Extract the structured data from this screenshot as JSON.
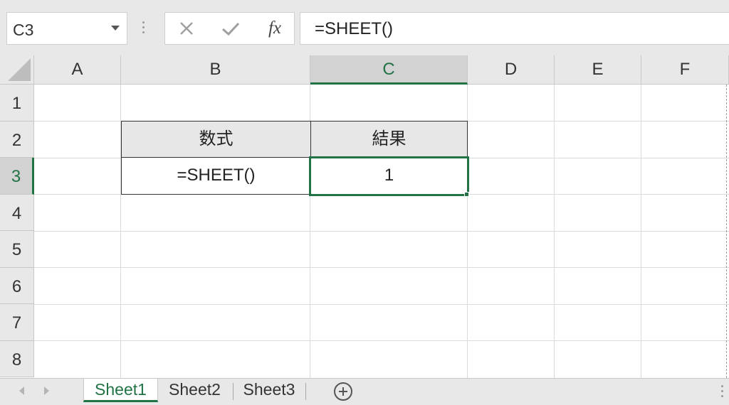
{
  "formula_bar": {
    "name_box": "C3",
    "cancel_icon": "x-icon",
    "enter_icon": "check-icon",
    "fx_label": "fx",
    "formula": "=SHEET()"
  },
  "columns": [
    "A",
    "B",
    "C",
    "D",
    "E",
    "F"
  ],
  "selected_column": "C",
  "rows": [
    "1",
    "2",
    "3",
    "4",
    "5",
    "6",
    "7",
    "8"
  ],
  "selected_row": "3",
  "table": {
    "header_formula": "数式",
    "header_result": "結果",
    "cell_formula": "=SHEET()",
    "cell_result": "1"
  },
  "sheet_tabs": {
    "tabs": [
      "Sheet1",
      "Sheet2",
      "Sheet3"
    ],
    "active": "Sheet1",
    "add_icon": "plus-circle-icon"
  },
  "colors": {
    "accent": "#217346",
    "header_bg": "#e8e8e8",
    "table_header_bg": "#e7e7e7"
  }
}
